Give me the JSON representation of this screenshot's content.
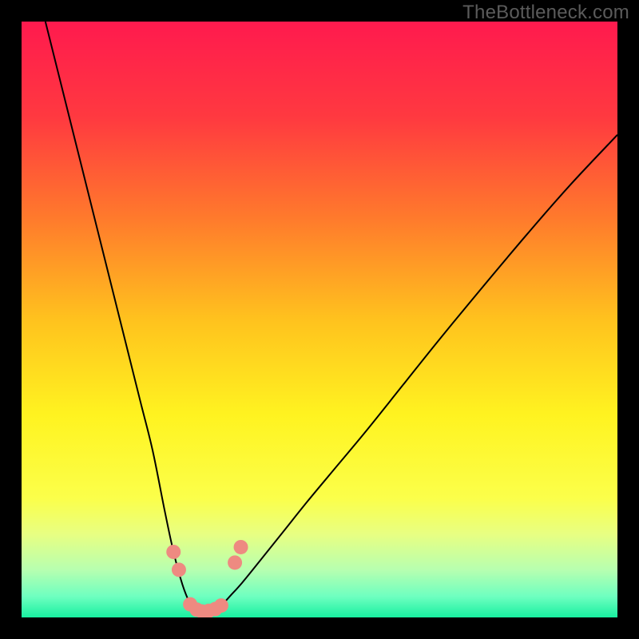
{
  "watermark": "TheBottleneck.com",
  "chart_data": {
    "type": "line",
    "title": "",
    "xlabel": "",
    "ylabel": "",
    "xlim": [
      0,
      100
    ],
    "ylim": [
      0,
      100
    ],
    "grid": false,
    "legend": false,
    "background_gradient_stops": [
      {
        "offset": 0.0,
        "color": "#ff1a4e"
      },
      {
        "offset": 0.16,
        "color": "#ff3940"
      },
      {
        "offset": 0.33,
        "color": "#ff7a2c"
      },
      {
        "offset": 0.5,
        "color": "#ffc21e"
      },
      {
        "offset": 0.66,
        "color": "#fff320"
      },
      {
        "offset": 0.8,
        "color": "#fbff4a"
      },
      {
        "offset": 0.86,
        "color": "#e8ff82"
      },
      {
        "offset": 0.92,
        "color": "#b7ffb0"
      },
      {
        "offset": 0.965,
        "color": "#6effc0"
      },
      {
        "offset": 1.0,
        "color": "#18f0a0"
      }
    ],
    "series": [
      {
        "name": "bottleneck-curve",
        "color": "#000000",
        "width": 2.0,
        "x": [
          4,
          6,
          8,
          10,
          12,
          14,
          16,
          18,
          20,
          22,
          24,
          25.5,
          27,
          28.3,
          29,
          30,
          31,
          32,
          33.5,
          35,
          37,
          40,
          44,
          48,
          53,
          58,
          64,
          70,
          77,
          85,
          92,
          100
        ],
        "y": [
          100,
          92,
          84,
          76,
          68,
          60,
          52,
          44,
          36,
          28,
          18,
          11,
          5.5,
          2.2,
          1.2,
          0.7,
          0.7,
          1.1,
          2.0,
          3.6,
          5.8,
          9.5,
          14.5,
          19.5,
          25.5,
          31.5,
          39,
          46.5,
          55,
          64.5,
          72.5,
          81
        ]
      }
    ],
    "markers": {
      "name": "highlight-points",
      "color": "#ee8a81",
      "radius": 9,
      "points": [
        {
          "x": 25.5,
          "y": 11.0
        },
        {
          "x": 26.4,
          "y": 8.0
        },
        {
          "x": 28.3,
          "y": 2.2
        },
        {
          "x": 29.4,
          "y": 1.3
        },
        {
          "x": 30.3,
          "y": 1.0
        },
        {
          "x": 31.4,
          "y": 1.1
        },
        {
          "x": 32.5,
          "y": 1.4
        },
        {
          "x": 33.5,
          "y": 2.0
        },
        {
          "x": 35.8,
          "y": 9.2
        },
        {
          "x": 36.8,
          "y": 11.8
        }
      ]
    }
  }
}
